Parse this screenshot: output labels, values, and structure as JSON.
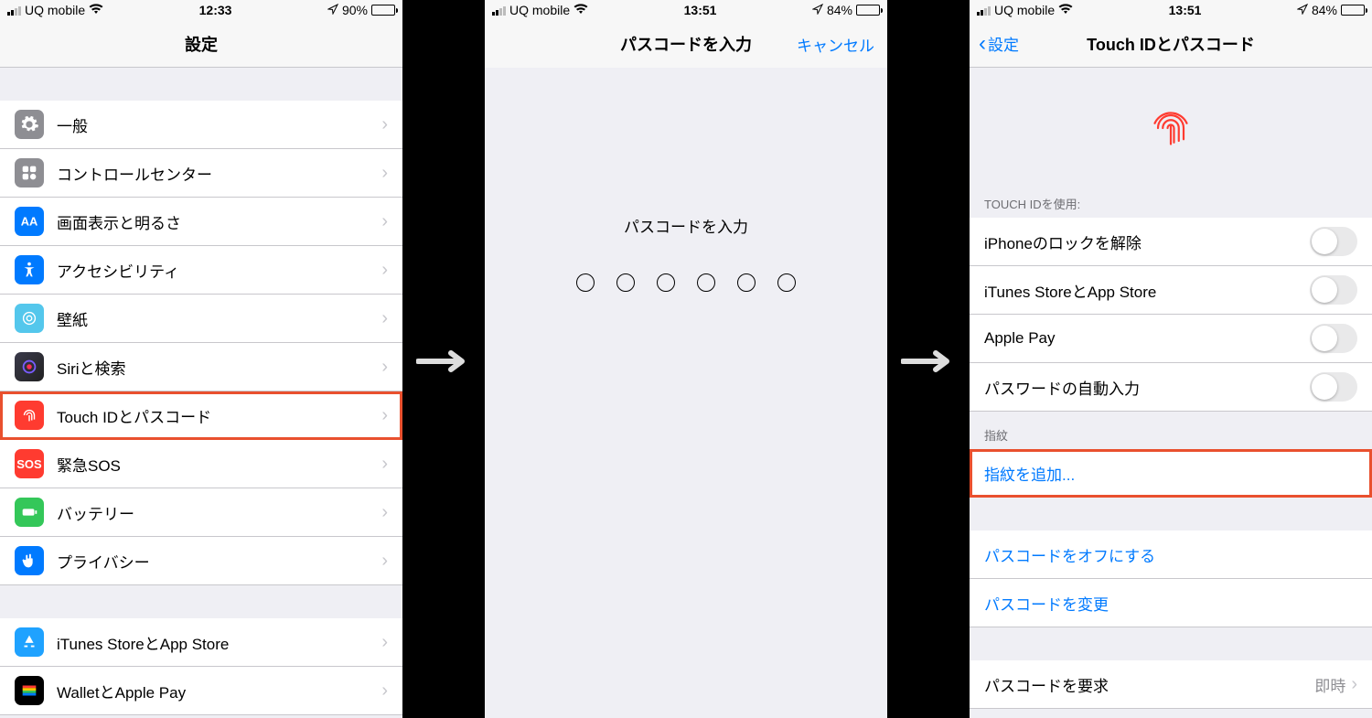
{
  "status": {
    "carrier": "UQ mobile",
    "time1": "12:33",
    "time2": "13:51",
    "battery1_pct": "90%",
    "battery2_pct": "84%"
  },
  "screen1": {
    "title": "設定",
    "rows": {
      "general": "一般",
      "control_center": "コントロールセンター",
      "display": "画面表示と明るさ",
      "accessibility": "アクセシビリティ",
      "wallpaper": "壁紙",
      "siri": "Siriと検索",
      "touchid": "Touch IDとパスコード",
      "sos": "緊急SOS",
      "battery": "バッテリー",
      "privacy": "プライバシー",
      "itunes": "iTunes StoreとApp Store",
      "wallet": "WalletとApple Pay"
    }
  },
  "screen2": {
    "title": "パスコードを入力",
    "cancel": "キャンセル",
    "prompt": "パスコードを入力"
  },
  "screen3": {
    "back": "設定",
    "title": "Touch IDとパスコード",
    "section_use": "TOUCH IDを使用:",
    "rows": {
      "unlock": "iPhoneのロックを解除",
      "itunes": "iTunes StoreとApp Store",
      "applepay": "Apple Pay",
      "autofill": "パスワードの自動入力"
    },
    "section_finger": "指紋",
    "add_finger": "指紋を追加...",
    "passcode_off": "パスコードをオフにする",
    "passcode_change": "パスコードを変更",
    "require_label": "パスコードを要求",
    "require_value": "即時"
  }
}
